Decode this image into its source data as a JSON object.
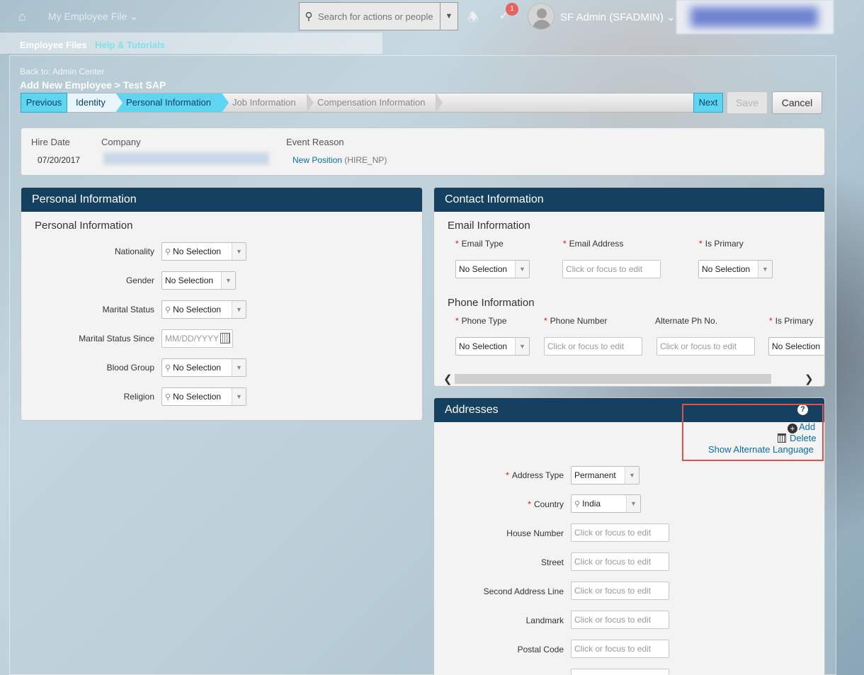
{
  "topbar": {
    "module_menu": "My Employee File",
    "search_placeholder": "Search for actions or people",
    "notification_count": "1",
    "user_name": "SF Admin (SFADMIN)"
  },
  "subnav": {
    "item1": "Employee Files",
    "item2": "Help & Tutorials"
  },
  "page": {
    "back_link": "Back to: Admin Center",
    "title": "Add New Employee > Test SAP"
  },
  "wizard": {
    "previous": "Previous",
    "next": "Next",
    "steps": [
      "Identity",
      "Personal Information",
      "Job Information",
      "Compensation Information"
    ],
    "save": "Save",
    "cancel": "Cancel"
  },
  "header": {
    "hire_date_label": "Hire Date",
    "hire_date": "07/20/2017",
    "company_label": "Company",
    "event_reason_label": "Event Reason",
    "event_reason_link": "New Position",
    "event_reason_code": "(HIRE_NP)"
  },
  "personal": {
    "panel_title": "Personal Information",
    "section_title": "Personal Information",
    "fields": [
      {
        "label": "Nationality",
        "value": "No Selection"
      },
      {
        "label": "Gender",
        "value": "No Selection"
      },
      {
        "label": "Marital Status",
        "value": "No Selection"
      },
      {
        "label": "Marital Status Since",
        "value": "MM/DD/YYYY"
      },
      {
        "label": "Blood Group",
        "value": "No Selection"
      },
      {
        "label": "Religion",
        "value": "No Selection"
      }
    ]
  },
  "contact": {
    "panel_title": "Contact Information",
    "email_section": "Email Information",
    "email_type_label": "Email Type",
    "email_address_label": "Email Address",
    "email_primary_label": "Is Primary",
    "email_type_value": "No Selection",
    "email_address_placeholder": "Click or focus to edit",
    "email_primary_value": "No Selection",
    "phone_section": "Phone Information",
    "phone_type_label": "Phone Type",
    "phone_number_label": "Phone Number",
    "alt_phone_label": "Alternate Ph No.",
    "phone_primary_label": "Is Primary",
    "phone_type_value": "No Selection",
    "phone_number_placeholder": "Click or focus to edit",
    "alt_phone_placeholder": "Click or focus to edit",
    "phone_primary_value": "No Selection"
  },
  "addresses": {
    "panel_title": "Addresses",
    "add": "Add",
    "delete": "Delete",
    "alt_language": "Show Alternate Language",
    "address_type_label": "Address Type",
    "address_type_value": "Permanent",
    "country_label": "Country",
    "country_value": "India",
    "house_number_label": "House Number",
    "street_label": "Street",
    "second_line_label": "Second Address Line",
    "landmark_label": "Landmark",
    "postal_code_label": "Postal Code",
    "placeholder": "Click or focus to edit"
  },
  "colors": {
    "panel_header": "#15405f",
    "wizard_active": "#5fd5f2",
    "link": "#0a6ea6",
    "highlight": "#d9534f"
  }
}
